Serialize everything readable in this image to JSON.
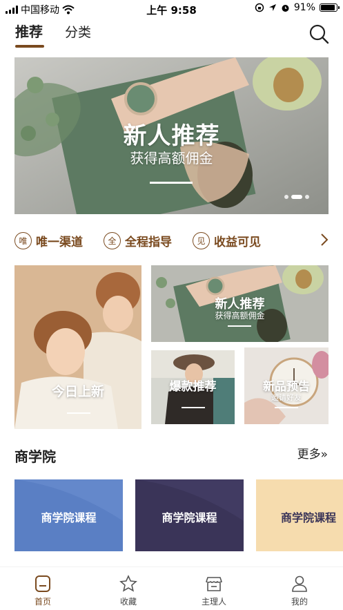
{
  "status_bar": {
    "carrier": "中国移动",
    "time": "上午 9:58",
    "battery": "91%",
    "battery_level": 0.91
  },
  "tabs": [
    {
      "label": "推荐",
      "active": true
    },
    {
      "label": "分类",
      "active": false
    }
  ],
  "banner": {
    "title": "新人推荐",
    "subtitle": "获得高额佣金",
    "slide_count": 3,
    "active_slide": 1
  },
  "features": [
    {
      "icon": "唯",
      "label": "唯一渠道"
    },
    {
      "icon": "全",
      "label": "全程指导"
    },
    {
      "icon": "见",
      "label": "收益可见"
    }
  ],
  "tiles": {
    "today": {
      "title": "今日上新"
    },
    "newcomer": {
      "title": "新人推荐",
      "subtitle": "获得高额佣金"
    },
    "hot": {
      "title": "爆款推荐"
    },
    "preview": {
      "title": "新品预告",
      "subtitle": "邀请好友"
    }
  },
  "academy": {
    "title": "商学院",
    "more_label": "更多",
    "courses": [
      {
        "label": "商学院课程"
      },
      {
        "label": "商学院课程"
      },
      {
        "label": "商学院课程"
      }
    ]
  },
  "bottom_nav": [
    {
      "label": "首页",
      "icon": "home-icon",
      "active": true
    },
    {
      "label": "收藏",
      "icon": "star-icon",
      "active": false
    },
    {
      "label": "主理人",
      "icon": "store-icon",
      "active": false
    },
    {
      "label": "我的",
      "icon": "user-icon",
      "active": false
    }
  ],
  "colors": {
    "accent": "#7a4a1f",
    "course_1": "#5a7fc4",
    "course_2": "#3a3458",
    "course_3": "#f6dcae"
  }
}
